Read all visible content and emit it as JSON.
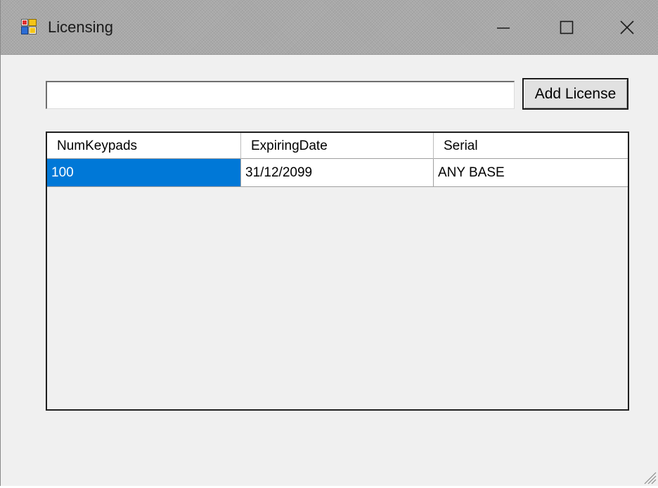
{
  "window": {
    "title": "Licensing",
    "icon": "app-window-icon",
    "controls": {
      "minimize": "minimize-icon",
      "maximize": "maximize-icon",
      "close": "close-icon"
    }
  },
  "license_form": {
    "input_value": "",
    "add_button_label": "Add License"
  },
  "license_table": {
    "columns": [
      "NumKeypads",
      "ExpiringDate",
      "Serial"
    ],
    "rows": [
      [
        "100",
        "31/12/2099",
        "ANY BASE"
      ]
    ],
    "selected_row": 0,
    "selected_column": 0
  },
  "colors": {
    "selection": "#0078d7",
    "window_background": "#f0f0f0",
    "titlebar": "#a9a9a9"
  }
}
